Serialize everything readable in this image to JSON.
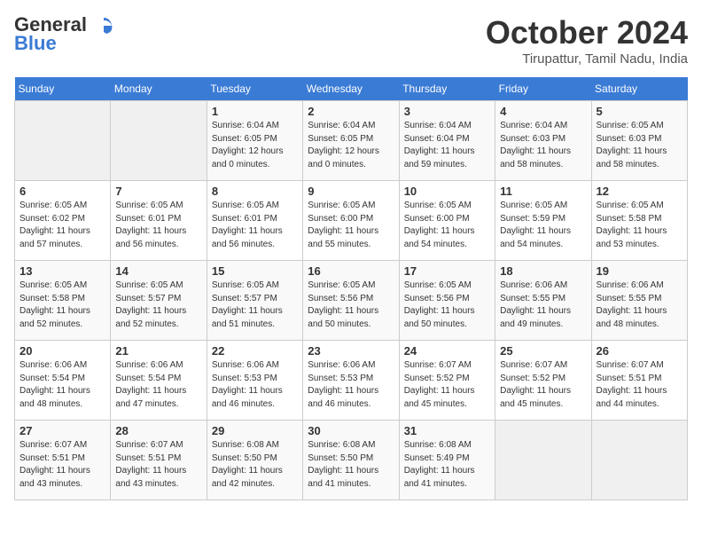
{
  "logo": {
    "line1": "General",
    "line2": "Blue"
  },
  "title": "October 2024",
  "location": "Tirupattur, Tamil Nadu, India",
  "days_of_week": [
    "Sunday",
    "Monday",
    "Tuesday",
    "Wednesday",
    "Thursday",
    "Friday",
    "Saturday"
  ],
  "weeks": [
    [
      {
        "day": "",
        "info": ""
      },
      {
        "day": "",
        "info": ""
      },
      {
        "day": "1",
        "info": "Sunrise: 6:04 AM\nSunset: 6:05 PM\nDaylight: 12 hours\nand 0 minutes."
      },
      {
        "day": "2",
        "info": "Sunrise: 6:04 AM\nSunset: 6:05 PM\nDaylight: 12 hours\nand 0 minutes."
      },
      {
        "day": "3",
        "info": "Sunrise: 6:04 AM\nSunset: 6:04 PM\nDaylight: 11 hours\nand 59 minutes."
      },
      {
        "day": "4",
        "info": "Sunrise: 6:04 AM\nSunset: 6:03 PM\nDaylight: 11 hours\nand 58 minutes."
      },
      {
        "day": "5",
        "info": "Sunrise: 6:05 AM\nSunset: 6:03 PM\nDaylight: 11 hours\nand 58 minutes."
      }
    ],
    [
      {
        "day": "6",
        "info": "Sunrise: 6:05 AM\nSunset: 6:02 PM\nDaylight: 11 hours\nand 57 minutes."
      },
      {
        "day": "7",
        "info": "Sunrise: 6:05 AM\nSunset: 6:01 PM\nDaylight: 11 hours\nand 56 minutes."
      },
      {
        "day": "8",
        "info": "Sunrise: 6:05 AM\nSunset: 6:01 PM\nDaylight: 11 hours\nand 56 minutes."
      },
      {
        "day": "9",
        "info": "Sunrise: 6:05 AM\nSunset: 6:00 PM\nDaylight: 11 hours\nand 55 minutes."
      },
      {
        "day": "10",
        "info": "Sunrise: 6:05 AM\nSunset: 6:00 PM\nDaylight: 11 hours\nand 54 minutes."
      },
      {
        "day": "11",
        "info": "Sunrise: 6:05 AM\nSunset: 5:59 PM\nDaylight: 11 hours\nand 54 minutes."
      },
      {
        "day": "12",
        "info": "Sunrise: 6:05 AM\nSunset: 5:58 PM\nDaylight: 11 hours\nand 53 minutes."
      }
    ],
    [
      {
        "day": "13",
        "info": "Sunrise: 6:05 AM\nSunset: 5:58 PM\nDaylight: 11 hours\nand 52 minutes."
      },
      {
        "day": "14",
        "info": "Sunrise: 6:05 AM\nSunset: 5:57 PM\nDaylight: 11 hours\nand 52 minutes."
      },
      {
        "day": "15",
        "info": "Sunrise: 6:05 AM\nSunset: 5:57 PM\nDaylight: 11 hours\nand 51 minutes."
      },
      {
        "day": "16",
        "info": "Sunrise: 6:05 AM\nSunset: 5:56 PM\nDaylight: 11 hours\nand 50 minutes."
      },
      {
        "day": "17",
        "info": "Sunrise: 6:05 AM\nSunset: 5:56 PM\nDaylight: 11 hours\nand 50 minutes."
      },
      {
        "day": "18",
        "info": "Sunrise: 6:06 AM\nSunset: 5:55 PM\nDaylight: 11 hours\nand 49 minutes."
      },
      {
        "day": "19",
        "info": "Sunrise: 6:06 AM\nSunset: 5:55 PM\nDaylight: 11 hours\nand 48 minutes."
      }
    ],
    [
      {
        "day": "20",
        "info": "Sunrise: 6:06 AM\nSunset: 5:54 PM\nDaylight: 11 hours\nand 48 minutes."
      },
      {
        "day": "21",
        "info": "Sunrise: 6:06 AM\nSunset: 5:54 PM\nDaylight: 11 hours\nand 47 minutes."
      },
      {
        "day": "22",
        "info": "Sunrise: 6:06 AM\nSunset: 5:53 PM\nDaylight: 11 hours\nand 46 minutes."
      },
      {
        "day": "23",
        "info": "Sunrise: 6:06 AM\nSunset: 5:53 PM\nDaylight: 11 hours\nand 46 minutes."
      },
      {
        "day": "24",
        "info": "Sunrise: 6:07 AM\nSunset: 5:52 PM\nDaylight: 11 hours\nand 45 minutes."
      },
      {
        "day": "25",
        "info": "Sunrise: 6:07 AM\nSunset: 5:52 PM\nDaylight: 11 hours\nand 45 minutes."
      },
      {
        "day": "26",
        "info": "Sunrise: 6:07 AM\nSunset: 5:51 PM\nDaylight: 11 hours\nand 44 minutes."
      }
    ],
    [
      {
        "day": "27",
        "info": "Sunrise: 6:07 AM\nSunset: 5:51 PM\nDaylight: 11 hours\nand 43 minutes."
      },
      {
        "day": "28",
        "info": "Sunrise: 6:07 AM\nSunset: 5:51 PM\nDaylight: 11 hours\nand 43 minutes."
      },
      {
        "day": "29",
        "info": "Sunrise: 6:08 AM\nSunset: 5:50 PM\nDaylight: 11 hours\nand 42 minutes."
      },
      {
        "day": "30",
        "info": "Sunrise: 6:08 AM\nSunset: 5:50 PM\nDaylight: 11 hours\nand 41 minutes."
      },
      {
        "day": "31",
        "info": "Sunrise: 6:08 AM\nSunset: 5:49 PM\nDaylight: 11 hours\nand 41 minutes."
      },
      {
        "day": "",
        "info": ""
      },
      {
        "day": "",
        "info": ""
      }
    ]
  ]
}
